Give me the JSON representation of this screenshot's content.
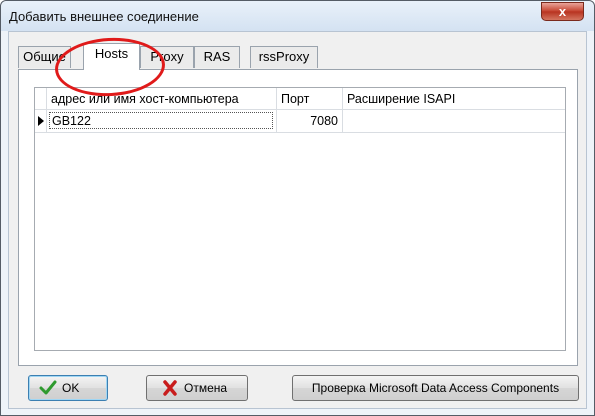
{
  "window": {
    "title": "Добавить внешнее соединение",
    "close_glyph": "x"
  },
  "tabs": [
    {
      "label": "Общие",
      "active": false
    },
    {
      "label": "Hosts",
      "active": true
    },
    {
      "label": "Proxy",
      "active": false
    },
    {
      "label": "RAS",
      "active": false
    },
    {
      "label": "rssProxy",
      "active": false
    }
  ],
  "grid": {
    "columns": [
      "адрес или имя хост-компьютера",
      "Порт",
      "Расширение ISAPI"
    ],
    "rows": [
      {
        "host": "GB122",
        "port": "7080",
        "isapi": "",
        "current": true
      }
    ]
  },
  "buttons": {
    "ok": "OK",
    "cancel": "Отмена",
    "check_mdac": "Проверка Microsoft Data Access Components"
  },
  "annotation": {
    "color": "#e01a1a",
    "target": "Hosts"
  },
  "colors": {
    "ok_check": "#2e9a2e",
    "cancel_x": "#c81c1c"
  }
}
